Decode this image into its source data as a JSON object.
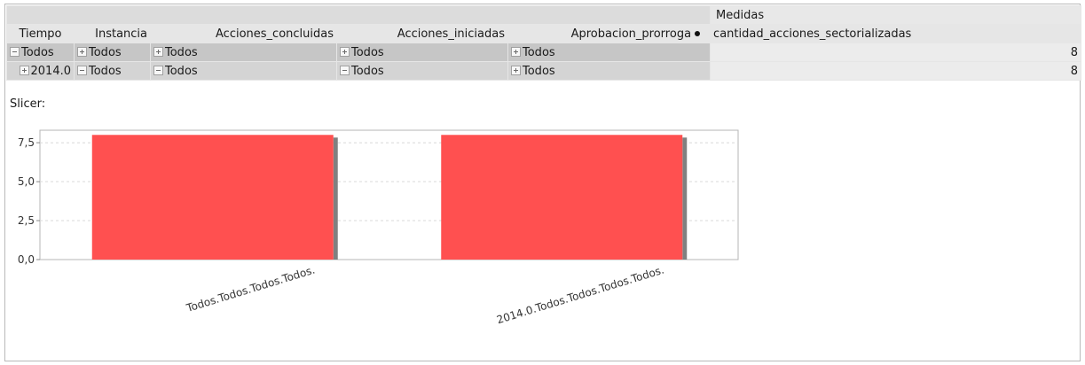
{
  "pivot": {
    "measures_header": "Medidas",
    "columns": [
      "Tiempo",
      "Instancia",
      "Acciones_concluidas",
      "Acciones_iniciadas",
      "Aprobacion_prorroga",
      "cantidad_acciones_sectorializadas"
    ],
    "rows": [
      {
        "tiempo": "Todos",
        "instancia": "Todos",
        "acciones_concluidas": "Todos",
        "acciones_iniciadas": "Todos",
        "aprobacion_prorroga": "Todos",
        "value": "8"
      },
      {
        "tiempo": "2014.0",
        "instancia": "Todos",
        "acciones_concluidas": "Todos",
        "acciones_iniciadas": "Todos",
        "aprobacion_prorroga": "Todos",
        "value": "8"
      }
    ]
  },
  "slicer_label": "Slicer:",
  "chart_data": {
    "type": "bar",
    "categories": [
      "Todos.Todos.Todos.Todos.",
      "2014.0.Todos.Todos.Todos.Todos."
    ],
    "values": [
      8,
      8
    ],
    "ylim": [
      0,
      8.3
    ],
    "yticks": [
      0,
      2.5,
      5,
      7.5
    ],
    "ytick_labels": [
      "0,0",
      "2,5",
      "5,0",
      "7,5"
    ],
    "bar_color": "#ff5050",
    "shadow_color": "#808080",
    "grid": true
  }
}
